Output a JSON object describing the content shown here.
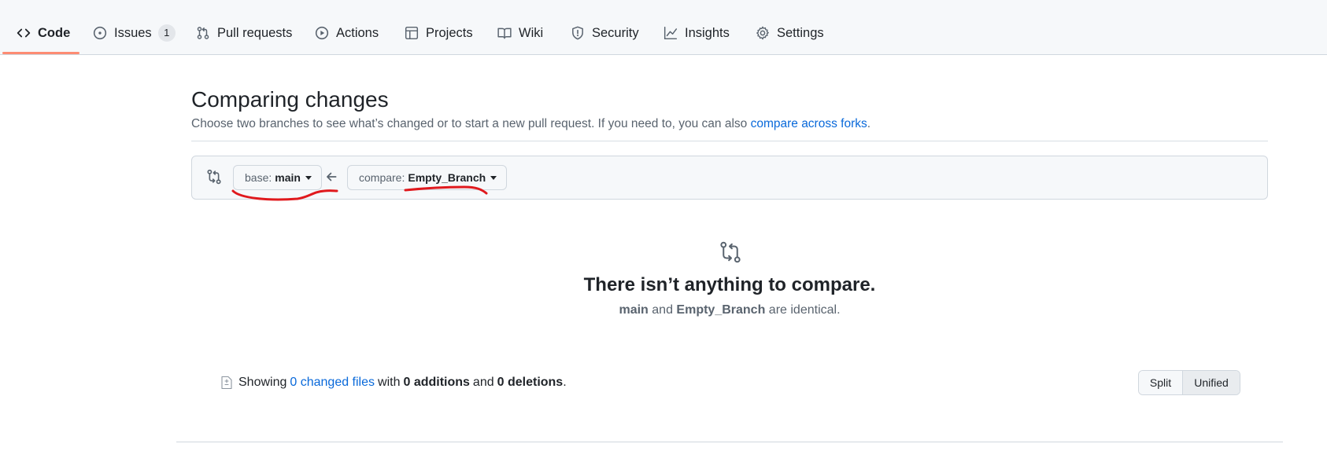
{
  "nav": {
    "tabs": [
      {
        "label": "Code",
        "icon": "code-icon"
      },
      {
        "label": "Issues",
        "icon": "issue-icon",
        "count": "1"
      },
      {
        "label": "Pull requests",
        "icon": "pull-request-icon"
      },
      {
        "label": "Actions",
        "icon": "play-icon"
      },
      {
        "label": "Projects",
        "icon": "table-icon"
      },
      {
        "label": "Wiki",
        "icon": "book-icon"
      },
      {
        "label": "Security",
        "icon": "shield-icon"
      },
      {
        "label": "Insights",
        "icon": "graph-icon"
      },
      {
        "label": "Settings",
        "icon": "gear-icon"
      }
    ],
    "active": "Code",
    "underline_color": "#fd8c73"
  },
  "header": {
    "title": "Comparing changes",
    "subtitle": "Choose two branches to see what’s changed or to start a new pull request. If you need to, you can also",
    "subtitle_link": "compare across forks",
    "subtitle_end": "."
  },
  "compare": {
    "base_label": "base:",
    "base_value": "main",
    "compare_label": "compare:",
    "compare_value": "Empty_Branch",
    "annotation_color": "#e0191d"
  },
  "blankslate": {
    "icon": "git-compare-icon",
    "title": "There isn’t anything to compare.",
    "base": "main",
    "and": "and",
    "compare": "Empty_Branch",
    "suffix": "are identical."
  },
  "toc": {
    "icon": "file-diff-icon",
    "showing": "Showing",
    "changed_files": "0 changed files",
    "with": "with",
    "additions": "0 additions",
    "and": "and",
    "deletions": "0 deletions",
    "end": "."
  },
  "view_toggle": {
    "split": "Split",
    "unified": "Unified",
    "selected": "Unified"
  },
  "colors": {
    "link": "#0969da",
    "nav_bg": "#f6f8fa",
    "border": "#d0d7de"
  }
}
